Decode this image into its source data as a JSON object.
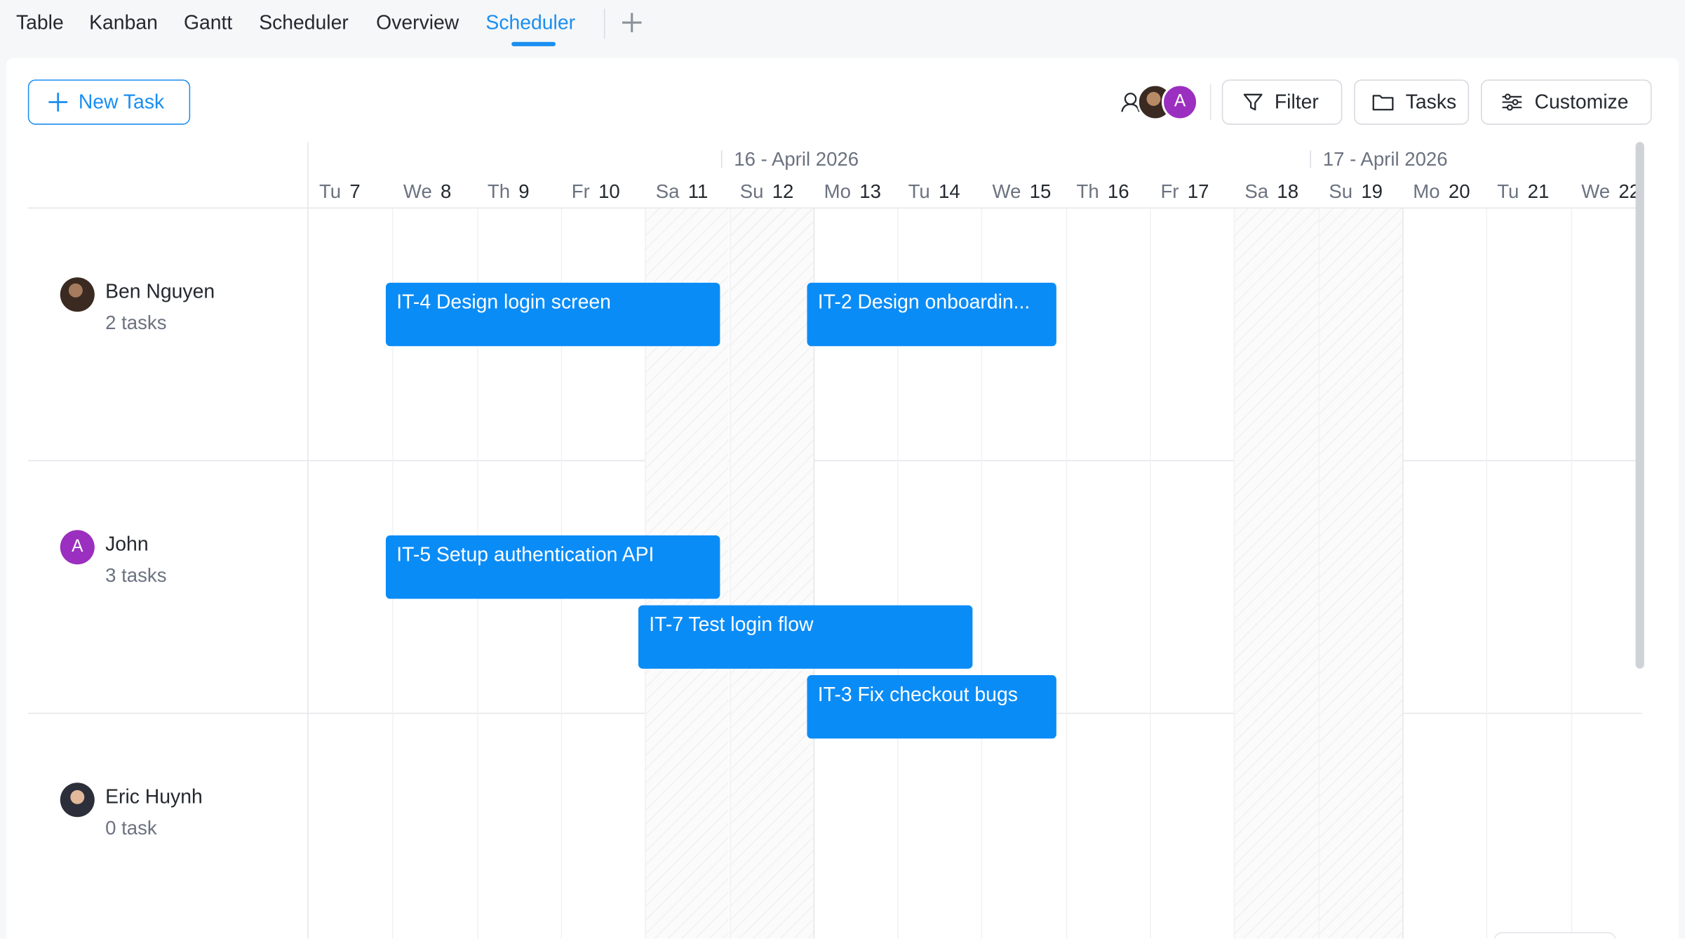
{
  "tabs": {
    "items": [
      {
        "label": "Table"
      },
      {
        "label": "Kanban"
      },
      {
        "label": "Gantt"
      },
      {
        "label": "Scheduler"
      },
      {
        "label": "Overview"
      },
      {
        "label": "Scheduler",
        "active": true
      }
    ]
  },
  "toolbar": {
    "new_task_label": "New Task",
    "filter_label": "Filter",
    "tasks_label": "Tasks",
    "customize_label": "Customize",
    "avatar_initial": "A"
  },
  "timeline": {
    "weeks": [
      {
        "label": "16 - April 2026"
      },
      {
        "label": "17 - April 2026"
      }
    ],
    "days": [
      {
        "dow": "Tu",
        "num": "7"
      },
      {
        "dow": "We",
        "num": "8"
      },
      {
        "dow": "Th",
        "num": "9"
      },
      {
        "dow": "Fr",
        "num": "10"
      },
      {
        "dow": "Sa",
        "num": "11"
      },
      {
        "dow": "Su",
        "num": "12"
      },
      {
        "dow": "Mo",
        "num": "13"
      },
      {
        "dow": "Tu",
        "num": "14"
      },
      {
        "dow": "We",
        "num": "15"
      },
      {
        "dow": "Th",
        "num": "16"
      },
      {
        "dow": "Fr",
        "num": "17"
      },
      {
        "dow": "Sa",
        "num": "18"
      },
      {
        "dow": "Su",
        "num": "19"
      },
      {
        "dow": "Mo",
        "num": "20"
      },
      {
        "dow": "Tu",
        "num": "21"
      },
      {
        "dow": "We",
        "num": "22"
      }
    ]
  },
  "resources": [
    {
      "name": "Ben Nguyen",
      "count": "2 tasks",
      "avatar": "photo-avatar",
      "avatar_color": "#3a2a22"
    },
    {
      "name": "John",
      "count": "3 tasks",
      "avatar": "initial-avatar",
      "initial": "A",
      "avatar_color": "#9b2fbf"
    },
    {
      "name": "Eric Huynh",
      "count": "0 task",
      "avatar": "photo-avatar",
      "avatar_color": "#2c2f3a"
    }
  ],
  "tasks": [
    {
      "label": "IT-4 Design login screen",
      "resource": "Ben Nguyen",
      "start": "We 8",
      "end": "Sa 11"
    },
    {
      "label": "IT-2 Design onboardin...",
      "resource": "Ben Nguyen",
      "start": "Mo 13",
      "end": "Tu 14"
    },
    {
      "label": "IT-5 Setup authentication API",
      "resource": "John",
      "start": "We 8",
      "end": "Sa 11"
    },
    {
      "label": "IT-7 Test login flow",
      "resource": "John",
      "start": "Sa 11",
      "end": "Tu 14"
    },
    {
      "label": "IT-3 Fix checkout bugs",
      "resource": "John",
      "start": "Mo 13",
      "end": "Tu 14"
    }
  ],
  "colors": {
    "accent": "#1a8ef0",
    "task_bar": "#0a8cf7",
    "avatar_purple": "#9b2fbf"
  }
}
